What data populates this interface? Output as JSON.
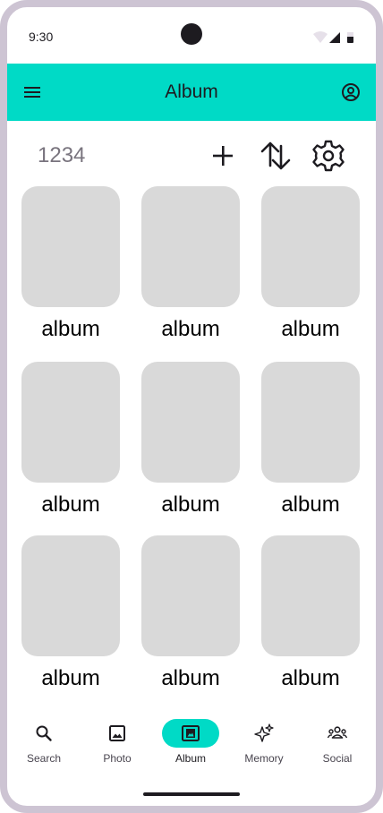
{
  "status": {
    "time": "9:30"
  },
  "appbar": {
    "title": "Album",
    "menu_icon": "menu-icon",
    "account_icon": "account-circle-icon"
  },
  "toolbar": {
    "count": "1234",
    "add_icon": "plus-icon",
    "sort_icon": "swap-vertical-icon",
    "settings_icon": "gear-icon"
  },
  "albums": [
    {
      "label": "album"
    },
    {
      "label": "album"
    },
    {
      "label": "album"
    },
    {
      "label": "album"
    },
    {
      "label": "album"
    },
    {
      "label": "album"
    },
    {
      "label": "album"
    },
    {
      "label": "album"
    },
    {
      "label": "album"
    }
  ],
  "nav": {
    "items": [
      {
        "label": "Search",
        "icon": "search-icon"
      },
      {
        "label": "Photo",
        "icon": "image-icon"
      },
      {
        "label": "Album",
        "icon": "photo-album-icon",
        "active": true
      },
      {
        "label": "Memory",
        "icon": "sparkles-icon"
      },
      {
        "label": "Social",
        "icon": "groups-icon"
      }
    ]
  },
  "colors": {
    "accent": "#00dac6",
    "placeholder": "#d9d9d9",
    "frame": "#cdc4d3"
  }
}
